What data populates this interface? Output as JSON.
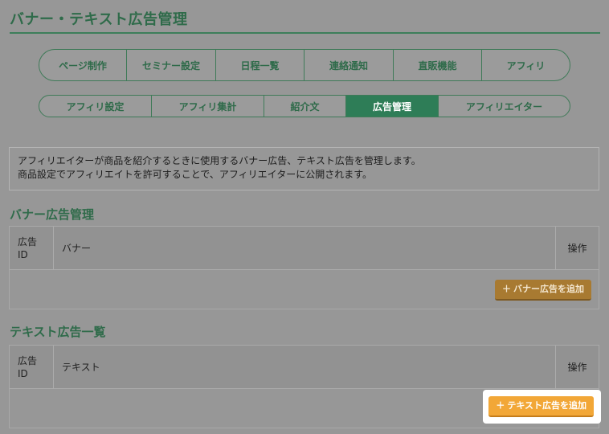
{
  "page": {
    "title": "バナー・テキスト広告管理"
  },
  "main_nav": [
    "ページ制作",
    "セミナー設定",
    "日程一覧",
    "連絡通知",
    "直販機能",
    "アフィリ"
  ],
  "sub_nav": [
    "アフィリ設定",
    "アフィリ集計",
    "紹介文",
    "広告管理",
    "アフィリエイター"
  ],
  "sub_nav_active": "広告管理",
  "description": {
    "line1": "アフィリエイターが商品を紹介するときに使用するバナー広告、テキスト広告を管理します。",
    "line2": "商品設定でアフィリエイトを許可することで、アフィリエイターに公開されます。"
  },
  "banner_section": {
    "title": "バナー広告管理",
    "col_id_line1": "広告",
    "col_id_line2": "ID",
    "col_content": "バナー",
    "col_action": "操作",
    "add_button": "バナー広告を追加"
  },
  "text_section": {
    "title": "テキスト広告一覧",
    "col_id_line1": "広告",
    "col_id_line2": "ID",
    "col_content": "テキスト",
    "col_action": "操作",
    "add_button": "テキスト広告を追加"
  },
  "icons": {
    "plus": "＋"
  },
  "colors": {
    "brand_green": "#2e7d57",
    "button_orange": "#f2a737",
    "overlay_gray": "#979797"
  }
}
